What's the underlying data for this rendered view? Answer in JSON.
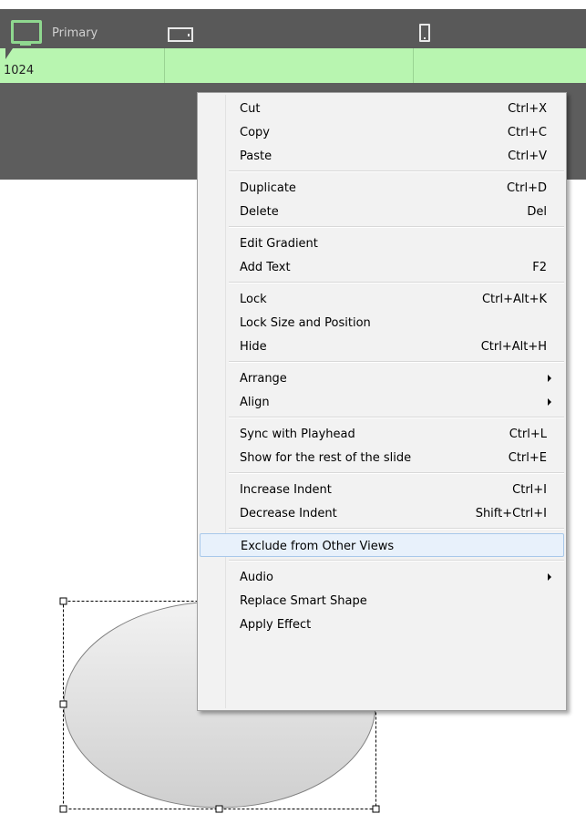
{
  "device_bar": {
    "primary_label": "Primary",
    "views": [
      {
        "name": "desktop-view",
        "icon": "monitor-icon"
      },
      {
        "name": "tablet-view",
        "icon": "tablet-icon"
      },
      {
        "name": "mobile-view",
        "icon": "phone-icon"
      }
    ],
    "colors": {
      "bar": "#595959",
      "active": "#8fd88f",
      "ruler": "#b8f5b0"
    }
  },
  "ruler": {
    "breakpoint_label": "1024"
  },
  "context_menu": {
    "groups": [
      [
        {
          "label": "Cut",
          "shortcut": "Ctrl+X"
        },
        {
          "label": "Copy",
          "shortcut": "Ctrl+C"
        },
        {
          "label": "Paste",
          "shortcut": "Ctrl+V"
        }
      ],
      [
        {
          "label": "Duplicate",
          "shortcut": "Ctrl+D"
        },
        {
          "label": "Delete",
          "shortcut": "Del"
        }
      ],
      [
        {
          "label": "Edit Gradient",
          "shortcut": ""
        },
        {
          "label": "Add Text",
          "shortcut": "F2"
        }
      ],
      [
        {
          "label": "Lock",
          "shortcut": "Ctrl+Alt+K"
        },
        {
          "label": "Lock Size and Position",
          "shortcut": ""
        },
        {
          "label": "Hide",
          "shortcut": "Ctrl+Alt+H"
        }
      ],
      [
        {
          "label": "Arrange",
          "shortcut": "",
          "submenu": true
        },
        {
          "label": "Align",
          "shortcut": "",
          "submenu": true
        }
      ],
      [
        {
          "label": "Sync with Playhead",
          "shortcut": "Ctrl+L"
        },
        {
          "label": "Show for the rest of the slide",
          "shortcut": "Ctrl+E"
        }
      ],
      [
        {
          "label": "Increase Indent",
          "shortcut": "Ctrl+I"
        },
        {
          "label": "Decrease Indent",
          "shortcut": "Shift+Ctrl+I"
        }
      ],
      [
        {
          "label": "Exclude from Other Views",
          "shortcut": "",
          "highlighted": true
        }
      ],
      [
        {
          "label": "Audio",
          "shortcut": "",
          "submenu": true
        },
        {
          "label": "Replace Smart Shape",
          "shortcut": ""
        },
        {
          "label": "Apply Effect",
          "shortcut": ""
        }
      ]
    ]
  },
  "shape": {
    "type": "ellipse",
    "fill_top": "#f2f2f2",
    "fill_bottom": "#cfcfcf",
    "stroke": "#808080"
  }
}
